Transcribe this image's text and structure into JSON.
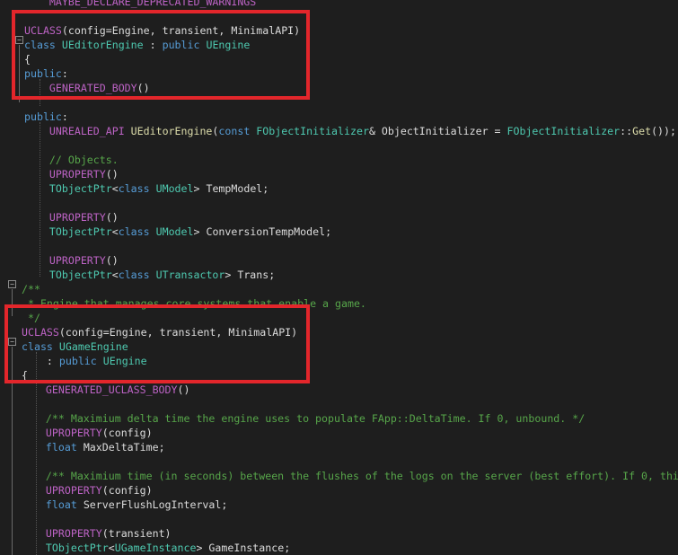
{
  "colors": {
    "background": "#1e1e1e",
    "text": "#dcdcdc",
    "keyword": "#569cd6",
    "type": "#4ec9b0",
    "comment": "#57a64a",
    "macro": "#bd63c5",
    "function": "#dcdcaa",
    "highlight_box": "#e3262b"
  },
  "icons": {
    "fold_collapse": "minus-box-icon"
  },
  "code_lines": [
    [
      {
        "t": "    MAYBE_DECLARE_DEPRECATED_WARNINGS",
        "c": "mc"
      }
    ],
    [],
    [
      {
        "t": "UCLASS",
        "c": "mc"
      },
      {
        "t": "(config=Engine, transient, MinimalAPI)",
        "c": "tx"
      }
    ],
    [
      {
        "t": "class ",
        "c": "kw"
      },
      {
        "t": "UEditorEngine",
        "c": "ty"
      },
      {
        "t": " : ",
        "c": "tx"
      },
      {
        "t": "public ",
        "c": "kw"
      },
      {
        "t": "UEngine",
        "c": "ty"
      }
    ],
    [
      {
        "t": "{",
        "c": "tx"
      }
    ],
    [
      {
        "t": "public",
        "c": "kw"
      },
      {
        "t": ":",
        "c": "tx"
      }
    ],
    [
      {
        "t": "    GENERATED_BODY",
        "c": "mc"
      },
      {
        "t": "()",
        "c": "tx"
      }
    ],
    [],
    [
      {
        "t": "public",
        "c": "kw"
      },
      {
        "t": ":",
        "c": "tx"
      }
    ],
    [
      {
        "t": "    UNREALED_API ",
        "c": "mc"
      },
      {
        "t": "UEditorEngine",
        "c": "fn"
      },
      {
        "t": "(",
        "c": "tx"
      },
      {
        "t": "const ",
        "c": "kw"
      },
      {
        "t": "FObjectInitializer",
        "c": "ty"
      },
      {
        "t": "& ObjectInitializer = ",
        "c": "tx"
      },
      {
        "t": "FObjectInitializer",
        "c": "ty"
      },
      {
        "t": "::",
        "c": "tx"
      },
      {
        "t": "Get",
        "c": "fn"
      },
      {
        "t": "());",
        "c": "tx"
      }
    ],
    [],
    [
      {
        "t": "    // Objects.",
        "c": "cm"
      }
    ],
    [
      {
        "t": "    UPROPERTY",
        "c": "mc"
      },
      {
        "t": "()",
        "c": "tx"
      }
    ],
    [
      {
        "t": "    TObjectPtr",
        "c": "ty"
      },
      {
        "t": "<",
        "c": "tx"
      },
      {
        "t": "class ",
        "c": "kw"
      },
      {
        "t": "UModel",
        "c": "ty"
      },
      {
        "t": "> TempModel;",
        "c": "tx"
      }
    ],
    [],
    [
      {
        "t": "    UPROPERTY",
        "c": "mc"
      },
      {
        "t": "()",
        "c": "tx"
      }
    ],
    [
      {
        "t": "    TObjectPtr",
        "c": "ty"
      },
      {
        "t": "<",
        "c": "tx"
      },
      {
        "t": "class ",
        "c": "kw"
      },
      {
        "t": "UModel",
        "c": "ty"
      },
      {
        "t": "> ConversionTempModel;",
        "c": "tx"
      }
    ],
    [],
    [
      {
        "t": "    UPROPERTY",
        "c": "mc"
      },
      {
        "t": "()",
        "c": "tx"
      }
    ],
    [
      {
        "t": "    TObjectPtr",
        "c": "ty"
      },
      {
        "t": "<",
        "c": "tx"
      },
      {
        "t": "class ",
        "c": "kw"
      },
      {
        "t": "UTransactor",
        "c": "ty"
      },
      {
        "t": "> Trans;",
        "c": "tx"
      }
    ],
    [
      {
        "t": "/**",
        "c": "cm"
      }
    ],
    [
      {
        "t": " * Engine that manages core systems that enable a game.",
        "c": "cm"
      }
    ],
    [
      {
        "t": " */",
        "c": "cm"
      }
    ],
    [
      {
        "t": "UCLASS",
        "c": "mc"
      },
      {
        "t": "(config=Engine, transient, MinimalAPI)",
        "c": "tx"
      }
    ],
    [
      {
        "t": "class ",
        "c": "kw"
      },
      {
        "t": "UGameEngine",
        "c": "ty"
      }
    ],
    [
      {
        "t": "    : ",
        "c": "tx"
      },
      {
        "t": "public ",
        "c": "kw"
      },
      {
        "t": "UEngine",
        "c": "ty"
      }
    ],
    [
      {
        "t": "{",
        "c": "tx"
      }
    ],
    [
      {
        "t": "    GENERATED_UCLASS_BODY",
        "c": "mc"
      },
      {
        "t": "()",
        "c": "tx"
      }
    ],
    [],
    [
      {
        "t": "    /** Maximium delta time the engine uses to populate FApp::DeltaTime. If 0, unbound. */",
        "c": "cm"
      }
    ],
    [
      {
        "t": "    UPROPERTY",
        "c": "mc"
      },
      {
        "t": "(config)",
        "c": "tx"
      }
    ],
    [
      {
        "t": "    float ",
        "c": "kw"
      },
      {
        "t": "MaxDeltaTime;",
        "c": "tx"
      }
    ],
    [],
    [
      {
        "t": "    /** Maximium time (in seconds) between the flushes of the logs on the server (best effort). If 0, thi",
        "c": "cm"
      }
    ],
    [
      {
        "t": "    UPROPERTY",
        "c": "mc"
      },
      {
        "t": "(config)",
        "c": "tx"
      }
    ],
    [
      {
        "t": "    float ",
        "c": "kw"
      },
      {
        "t": "ServerFlushLogInterval;",
        "c": "tx"
      }
    ],
    [],
    [
      {
        "t": "    UPROPERTY",
        "c": "mc"
      },
      {
        "t": "(transient)",
        "c": "tx"
      }
    ],
    [
      {
        "t": "    TObjectPtr",
        "c": "ty"
      },
      {
        "t": "<",
        "c": "tx"
      },
      {
        "t": "UGameInstance",
        "c": "ty"
      },
      {
        "t": "> GameInstance;",
        "c": "tx"
      }
    ],
    []
  ]
}
